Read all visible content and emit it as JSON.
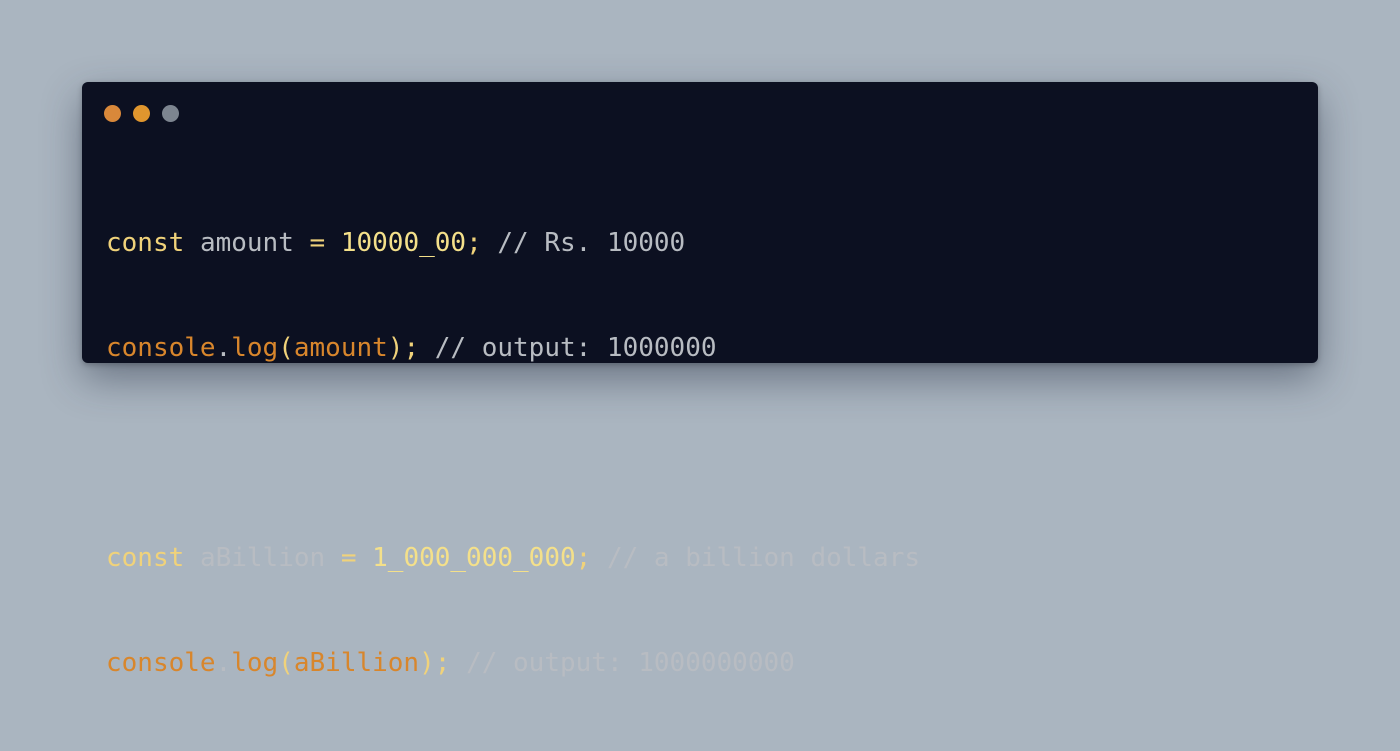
{
  "window": {
    "controls": [
      {
        "name": "close",
        "color": "#d9883a"
      },
      {
        "name": "minimize",
        "color": "#e0962e"
      },
      {
        "name": "maximize",
        "color": "#7d8590"
      }
    ]
  },
  "code": {
    "line1": {
      "keyword": "const",
      "identifier": "amount",
      "operator": "=",
      "number": "10000_00",
      "terminator": ";",
      "comment": "// Rs. 10000"
    },
    "line2": {
      "object": "console",
      "dot": ".",
      "method": "log",
      "open_paren": "(",
      "argument": "amount",
      "close_paren": ")",
      "terminator": ";",
      "comment": "// output: 1000000"
    },
    "line4": {
      "keyword": "const",
      "identifier": "aBillion",
      "operator": "=",
      "number": "1_000_000_000",
      "terminator": ";",
      "comment": "// a billion dollars"
    },
    "line5": {
      "object": "console",
      "dot": ".",
      "method": "log",
      "open_paren": "(",
      "argument": "aBillion",
      "close_paren": ")",
      "terminator": ";",
      "comment": "// output: 1000000000"
    }
  }
}
